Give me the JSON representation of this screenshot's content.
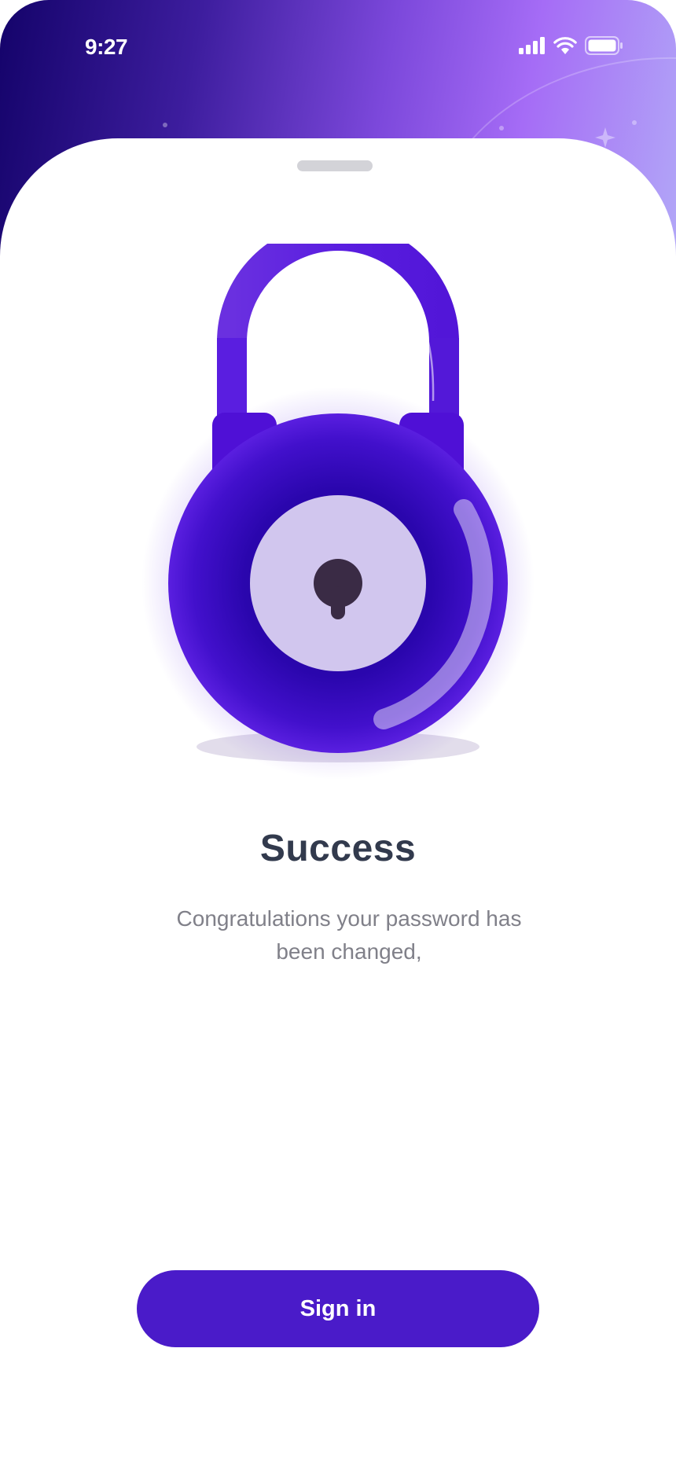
{
  "status_bar": {
    "time": "9:27",
    "icons": [
      "signal-icon",
      "wifi-icon",
      "battery-icon"
    ]
  },
  "screen": {
    "illustration": "padlock-icon",
    "title": "Success",
    "message": "Congratulations your password has been changed,",
    "sign_in_label": "Sign in"
  },
  "colors": {
    "primary": "#4a1bc9",
    "title": "#323a4d",
    "message": "#808089",
    "header_gradient": [
      "#14036a",
      "#7c48db",
      "#b2a8f7"
    ]
  }
}
